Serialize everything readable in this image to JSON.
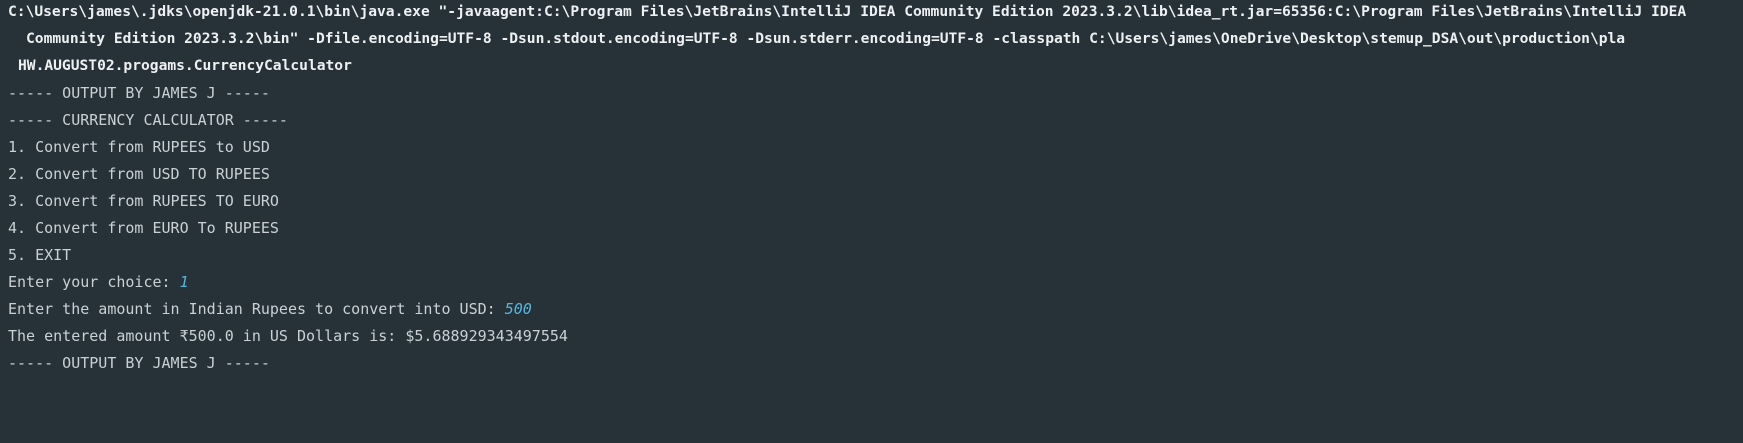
{
  "colors": {
    "background": "#263238",
    "text": "#c9d1d6",
    "command_text": "#eef1f2",
    "user_input": "#56b6e0"
  },
  "command": {
    "line1": "C:\\Users\\james\\.jdks\\openjdk-21.0.1\\bin\\java.exe \"-javaagent:C:\\Program Files\\JetBrains\\IntelliJ IDEA Community Edition 2023.3.2\\lib\\idea_rt.jar=65356:C:\\Program Files\\JetBrains\\IntelliJ IDEA",
    "line2": "Community Edition 2023.3.2\\bin\" -Dfile.encoding=UTF-8 -Dsun.stdout.encoding=UTF-8 -Dsun.stderr.encoding=UTF-8 -classpath C:\\Users\\james\\OneDrive\\Desktop\\stemup_DSA\\out\\production\\pla",
    "line3": "HW.AUGUST02.progams.CurrencyCalculator"
  },
  "output": {
    "header": "----- OUTPUT BY JAMES J -----",
    "title": "----- CURRENCY CALCULATOR -----",
    "menu": [
      "1. Convert from RUPEES to USD",
      "2. Convert from USD TO RUPEES",
      "3. Convert from RUPEES TO EURO",
      "4. Convert from EURO To RUPEES",
      "5. EXIT"
    ],
    "choice_prompt": "Enter your choice: ",
    "choice_value": "1",
    "amount_prompt": "Enter the amount in Indian Rupees to convert into USD: ",
    "amount_value": "500",
    "result": "The entered amount ₹500.0 in US Dollars is: $5.688929343497554",
    "footer": "----- OUTPUT BY JAMES J -----"
  }
}
